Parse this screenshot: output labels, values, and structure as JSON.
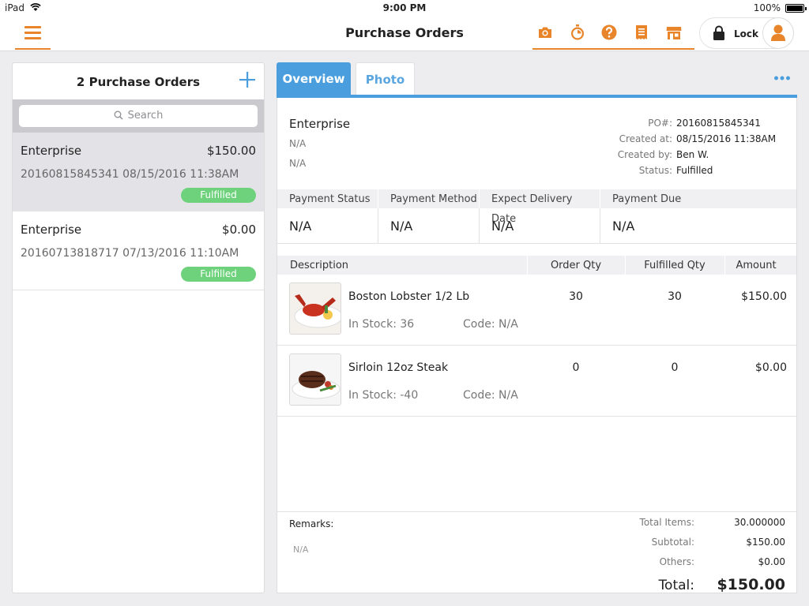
{
  "status_bar": {
    "device": "iPad",
    "time": "9:00 PM",
    "battery": "100%"
  },
  "nav": {
    "title": "Purchase Orders",
    "icons": [
      "camera-icon",
      "timer-icon",
      "help-icon",
      "receipt-icon",
      "store-icon"
    ],
    "lock_label": "Lock",
    "accent": "#e8842a"
  },
  "left": {
    "title": "2 Purchase Orders",
    "search_placeholder": "Search",
    "orders": [
      {
        "vendor": "Enterprise",
        "amount": "$150.00",
        "meta": "20160815845341 08/15/2016 11:38AM",
        "status": "Fulfilled"
      },
      {
        "vendor": "Enterprise",
        "amount": "$0.00",
        "meta": "20160713818717 07/13/2016 11:10AM",
        "status": "Fulfilled"
      }
    ]
  },
  "tabs": {
    "overview": "Overview",
    "photo": "Photo"
  },
  "po": {
    "vendor": "Enterprise",
    "line1": "N/A",
    "line2": "N/A",
    "info": [
      {
        "label": "PO#:",
        "value": "20160815845341"
      },
      {
        "label": "Created at:",
        "value": "08/15/2016 11:38AM"
      },
      {
        "label": "Created by:",
        "value": "Ben W."
      },
      {
        "label": "Status:",
        "value": "Fulfilled"
      }
    ]
  },
  "payment": {
    "headers": [
      "Payment Status",
      "Payment Method",
      "Expect Delivery Date",
      "Payment Due"
    ],
    "values": [
      "N/A",
      "N/A",
      "N/A",
      "N/A"
    ]
  },
  "items_table": {
    "headers": [
      "Description",
      "Order Qty",
      "Fulfilled Qty",
      "Amount"
    ],
    "rows": [
      {
        "name": "Boston Lobster 1/2 Lb",
        "stock": "In Stock: 36",
        "code": "Code: N/A",
        "order_qty": "30",
        "fulfilled_qty": "30",
        "amount": "$150.00"
      },
      {
        "name": "Sirloin 12oz Steak",
        "stock": "In Stock: -40",
        "code": "Code: N/A",
        "order_qty": "0",
        "fulfilled_qty": "0",
        "amount": "$0.00"
      }
    ]
  },
  "footer": {
    "remarks_label": "Remarks:",
    "remarks_value": "N/A",
    "totals": [
      {
        "label": "Total Items:",
        "value": "30.000000"
      },
      {
        "label": "Subtotal:",
        "value": "$150.00"
      },
      {
        "label": "Others:",
        "value": "$0.00"
      }
    ],
    "grand_label": "Total:",
    "grand_value": "$150.00"
  }
}
